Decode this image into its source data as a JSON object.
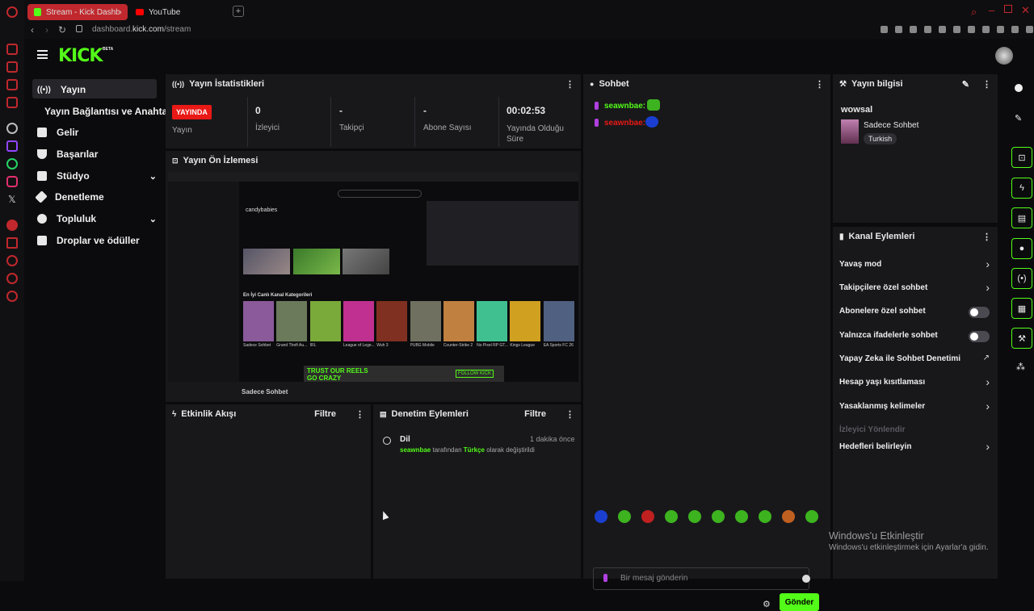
{
  "browser": {
    "tabs": [
      {
        "label": "Stream - Kick Dashboa"
      },
      {
        "label": "YouTube"
      }
    ],
    "url_host": "dashboard.",
    "url_domain": "kick.com",
    "url_path": "/stream"
  },
  "header": {
    "logo": "KICK",
    "logo_badge": "BETA"
  },
  "sidebar": {
    "items": [
      {
        "label": "Yayın"
      },
      {
        "label": "Yayın Bağlantısı ve Anahtarı"
      },
      {
        "label": "Gelir"
      },
      {
        "label": "Başarılar"
      },
      {
        "label": "Stüdyo"
      },
      {
        "label": "Denetleme"
      },
      {
        "label": "Topluluk"
      },
      {
        "label": "Droplar ve ödüller"
      }
    ]
  },
  "stats": {
    "title": "Yayın İstatistikleri",
    "live_badge": "YAYINDA",
    "live_label": "Yayın",
    "cells": [
      {
        "value": "0",
        "label": "İzleyici"
      },
      {
        "value": "-",
        "label": "Takipçi"
      },
      {
        "value": "-",
        "label": "Abone Sayısı"
      },
      {
        "value": "00:02:53",
        "label": "Yayında Olduğu Süre"
      }
    ]
  },
  "preview": {
    "title": "Yayın Ön İzlemesi",
    "inner_section": "En İyi Canlı Kanal Kategorileri",
    "inner_streamer": "candybabies",
    "inner_banner": "TRUST OUR REELS GO CRAZY",
    "inner_follow": "FOLLOW KICK",
    "caption": "Sadece Sohbet",
    "categories": [
      "Sadece Sohbet",
      "Grand Theft Au...",
      "IRL",
      "League of Lege...",
      "Wuh 3",
      "PUBG Mobile",
      "Counter-Strike 2",
      "No Pixel RP GT...",
      "Kings League",
      "EA Sports FC 26"
    ]
  },
  "activity": {
    "title": "Etkinlik Akışı",
    "filter": "Filtre"
  },
  "moderation": {
    "title": "Denetim Eylemleri",
    "filter": "Filtre",
    "entry": {
      "heading": "Dil",
      "time": "1 dakika önce",
      "user": "seawnbae",
      "mid": "tarafından",
      "lang": "Türkçe",
      "tail": "olarak değiştirildi"
    }
  },
  "chat": {
    "title": "Sohbet",
    "messages": [
      {
        "user": "seawnbae:"
      },
      {
        "user": "seawnbae:"
      }
    ],
    "placeholder": "Bir mesaj gönderin",
    "send": "Gönder"
  },
  "info": {
    "title": "Yayın bilgisi",
    "stream_title": "wowsal",
    "category": "Sadece Sohbet",
    "language": "Turkish"
  },
  "channel": {
    "title": "Kanal Eylemleri",
    "items": [
      {
        "label": "Yavaş mod",
        "kind": "chevron"
      },
      {
        "label": "Takipçilere özel sohbet",
        "kind": "chevron"
      },
      {
        "label": "Abonelere özel sohbet",
        "kind": "toggle"
      },
      {
        "label": "Yalnızca ifadelerle sohbet",
        "kind": "toggle"
      },
      {
        "label": "Yapay Zeka ile Sohbet Denetimi",
        "kind": "link"
      },
      {
        "label": "Hesap yaşı kısıtlaması",
        "kind": "chevron"
      },
      {
        "label": "Yasaklanmış kelimeler",
        "kind": "chevron"
      },
      {
        "label": "İzleyici Yönlendir",
        "kind": "disabled"
      },
      {
        "label": "Hedefleri belirleyin",
        "kind": "chevron"
      }
    ]
  },
  "watermark": {
    "title": "Windows'u Etkinleştir",
    "subtitle": "Windows'u etkinleştirmek için Ayarlar'a gidin."
  },
  "colors": {
    "accent": "#53fc18",
    "live": "#e91916",
    "panel": "#18181b",
    "bg": "#0b0b0d"
  }
}
